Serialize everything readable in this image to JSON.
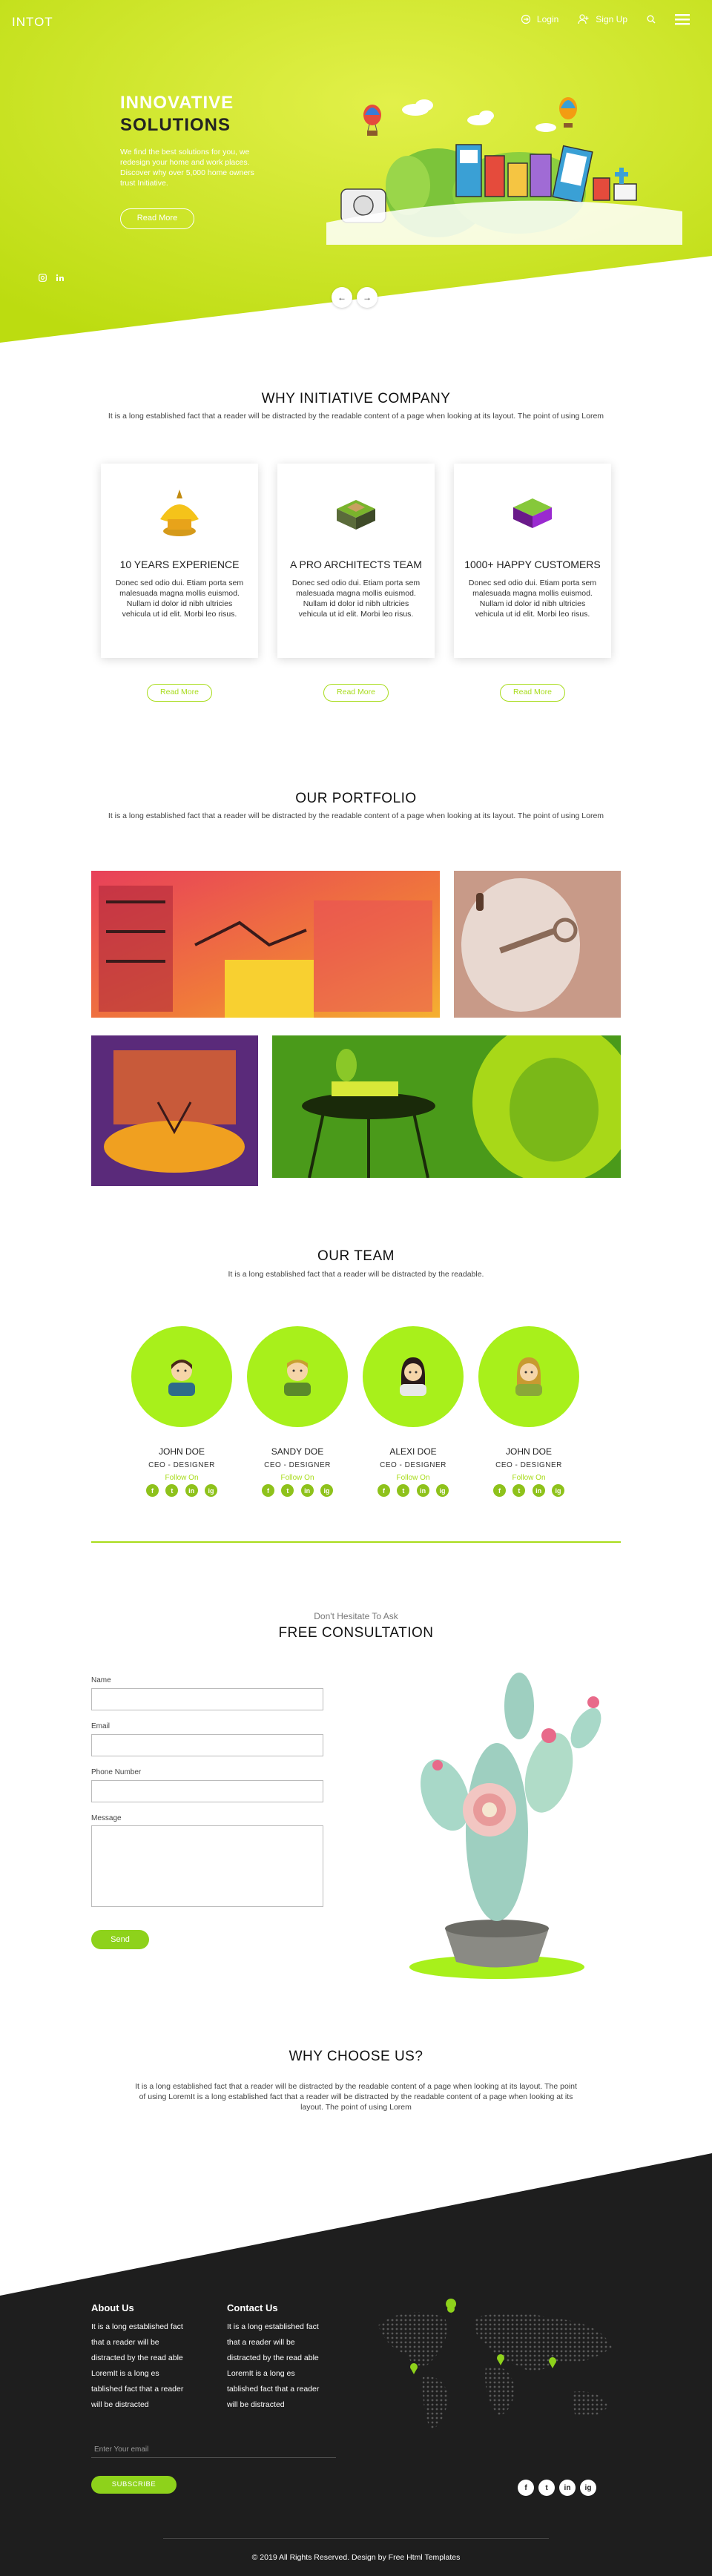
{
  "header": {
    "brand": "INTOT",
    "login_label": "Login",
    "signup_label": "Sign Up"
  },
  "hero": {
    "title_line1": "INNOVATIVE",
    "title_line2": "SOLUTIONS",
    "text": "We find the best solutions for you, we redesign your home and work places. Discover why over 5,000 home owners trust Initiative.",
    "button": "Read More",
    "prev_arrow": "←",
    "next_arrow": "→"
  },
  "why_company": {
    "title": "WHY INITIATIVE COMPANY",
    "subtitle": "It is a long established fact that a reader will be distracted by the readable content of a page when looking at its layout. The point of using Lorem",
    "cards": [
      {
        "title": "10 YEARS EXPERIENCE",
        "text": "Donec sed odio dui. Etiam porta sem malesuada magna mollis euismod. Nullam id dolor id nibh ultricies vehicula ut id elit. Morbi leo risus.",
        "button": "Read More"
      },
      {
        "title": "A PRO ARCHITECTS TEAM",
        "text": "Donec sed odio dui. Etiam porta sem malesuada magna mollis euismod. Nullam id dolor id nibh ultricies vehicula ut id elit. Morbi leo risus.",
        "button": "Read More"
      },
      {
        "title": "1000+ HAPPY CUSTOMERS",
        "text": "Donec sed odio dui. Etiam porta sem malesuada magna mollis euismod. Nullam id dolor id nibh ultricies vehicula ut id elit. Morbi leo risus.",
        "button": "Read More"
      }
    ]
  },
  "portfolio": {
    "title": "OUR PORTFOLIO",
    "subtitle": "It is a long established fact that a reader will be distracted by the readable content of a page when looking at its layout. The point of using Lorem"
  },
  "team": {
    "title": "OUR TEAM",
    "subtitle": "It is a long established fact that a reader will be distracted by the readable.",
    "members": [
      {
        "name": "JOHN DOE",
        "role": "CEO - DESIGNER",
        "follow": "Follow On"
      },
      {
        "name": "SANDY DOE",
        "role": "CEO - DESIGNER",
        "follow": "Follow On"
      },
      {
        "name": "ALEXI DOE",
        "role": "CEO - DESIGNER",
        "follow": "Follow On"
      },
      {
        "name": "JOHN DOE",
        "role": "CEO - DESIGNER",
        "follow": "Follow On"
      }
    ],
    "social": [
      "f",
      "t",
      "in",
      "ig"
    ]
  },
  "consultation": {
    "eyebrow": "Don't Hesitate To Ask",
    "title": "FREE CONSULTATION",
    "name_label": "Name",
    "email_label": "Email",
    "phone_label": "Phone Number",
    "message_label": "Message",
    "send": "Send"
  },
  "why_choose": {
    "title": "WHY CHOOSE US?",
    "text": "It is a long established fact that a reader will be distracted by the readable content of a page when looking at its layout. The point of using LoremIt is a long established fact that a reader will be distracted by the readable content of a page when looking at its layout. The point of using Lorem"
  },
  "footer": {
    "about_title": "About Us",
    "about_text": "It is a long established fact that a reader will be distracted by the read able LoremIt is a long es tablished fact that a reader will be distracted",
    "contact_title": "Contact Us",
    "contact_text": "It is a long established fact that a reader will be distracted by the read able LoremIt is a long es tablished fact that a reader will be distracted",
    "email_placeholder": "Enter Your email",
    "subscribe": "SUBSCRIBE",
    "social": [
      "f",
      "t",
      "in",
      "ig"
    ],
    "copyright": "© 2019 All Rights Reserved. Design by Free Html Templates"
  },
  "colors": {
    "accent": "#a8dc1b",
    "hero_bg": "#c8e21a",
    "footer_bg": "#1e1e1e"
  }
}
